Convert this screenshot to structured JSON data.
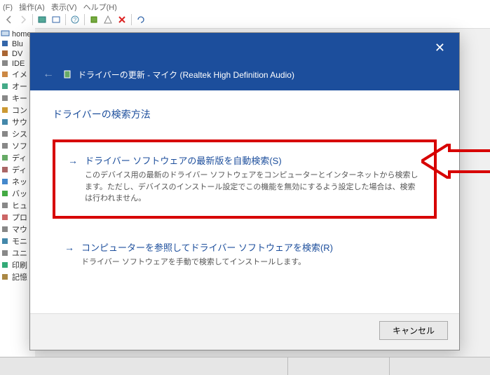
{
  "menu": {
    "f": "(F)",
    "sousa": "操作(A)",
    "hyouji": "表示(V)",
    "help": "ヘルプ(H)"
  },
  "tree": {
    "root": "home-…",
    "items": [
      "Blu",
      "DV",
      "IDE",
      "イメ",
      "オー",
      "キー",
      "コン",
      "サウ",
      "シス",
      "ソフ",
      "ディ",
      "ディ",
      "ネッ",
      "バッ",
      "ヒュ",
      "プロ",
      "マウ",
      "モニ",
      "ユニ",
      "印刷",
      "記憶"
    ]
  },
  "dialog": {
    "title": "ドライバーの更新 - マイク (Realtek High Definition Audio)",
    "heading": "ドライバーの検索方法",
    "option1": {
      "title": "ドライバー ソフトウェアの最新版を自動検索(S)",
      "desc": "このデバイス用の最新のドライバー ソフトウェアをコンピューターとインターネットから検索します。ただし、デバイスのインストール設定でこの機能を無効にするよう設定した場合は、検索は行われません。"
    },
    "option2": {
      "title": "コンピューターを参照してドライバー ソフトウェアを検索(R)",
      "desc": "ドライバー ソフトウェアを手動で検索してインストールします。"
    },
    "cancel": "キャンセル"
  }
}
